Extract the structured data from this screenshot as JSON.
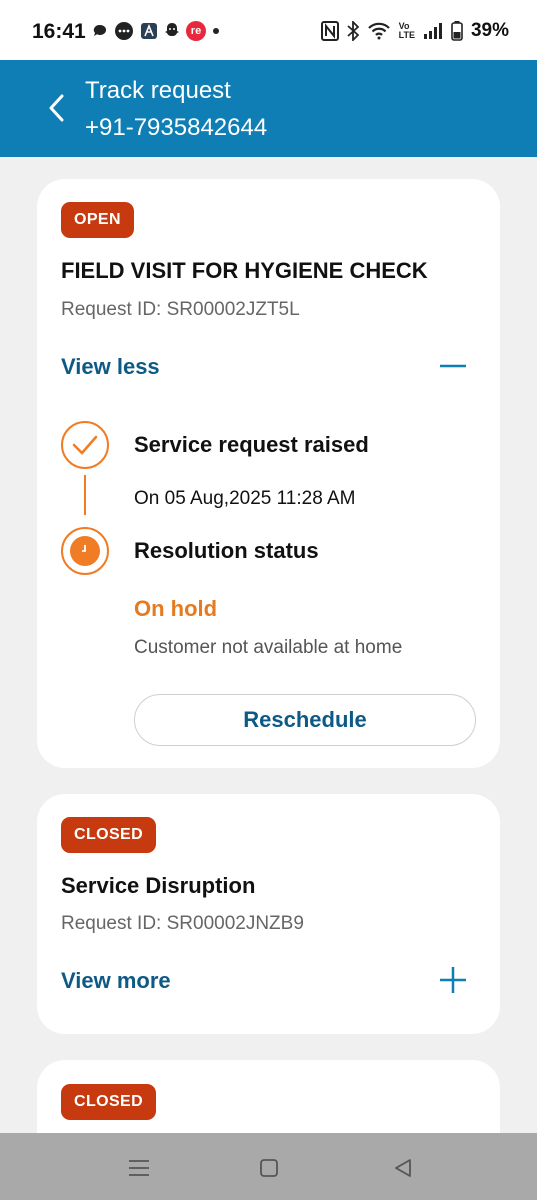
{
  "status_bar": {
    "time": "16:41",
    "battery": "39%",
    "left_icons": [
      "chat-icon",
      "message-icon",
      "app-a-icon",
      "app-snap-icon",
      "app-re-icon",
      "dot-icon"
    ],
    "right_icons": [
      "nfc-icon",
      "bluetooth-icon",
      "wifi-icon",
      "volte-icon",
      "signal-icon",
      "battery-icon"
    ],
    "volte_label_top": "Vo",
    "volte_label_bottom": "LTE",
    "re_label": "re"
  },
  "header": {
    "title": "Track request",
    "phone": "+91-7935842644",
    "background": "#0f7eb5"
  },
  "requests": [
    {
      "status": "OPEN",
      "title": "FIELD VISIT FOR HYGIENE CHECK",
      "request_id": "Request ID: SR00002JZT5L",
      "toggle_label": "View less",
      "expanded": true,
      "timeline": {
        "raised_title": "Service request raised",
        "raised_date": "On 05 Aug,2025 11:28 AM",
        "resolution_title": "Resolution status",
        "resolution_status": "On hold",
        "resolution_reason": "Customer not available at home"
      },
      "action_label": "Reschedule"
    },
    {
      "status": "CLOSED",
      "title": "Service Disruption",
      "request_id": "Request ID: SR00002JNZB9",
      "toggle_label": "View more",
      "expanded": false
    },
    {
      "status": "CLOSED"
    }
  ],
  "colors": {
    "accent": "#f07c26",
    "badge": "#c7390f",
    "link": "#0c5a85",
    "nav_bar": "#a9a9a9"
  },
  "nav": [
    "menu-icon",
    "home-square-icon",
    "back-triangle-icon"
  ]
}
